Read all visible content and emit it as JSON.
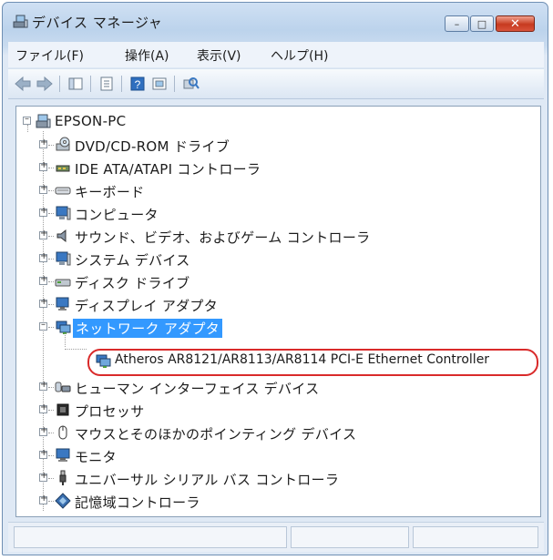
{
  "window": {
    "title": "デバイス マネージャ",
    "accent": "#bcd3ec",
    "controls": {
      "minimize": "–",
      "maximize": "□",
      "close": "✕"
    }
  },
  "menu": [
    "ファイル(F)",
    "操作(A)",
    "表示(V)",
    "ヘルプ(H)"
  ],
  "tree": {
    "root": "EPSON-PC",
    "categories": [
      "DVD/CD-ROM ドライブ",
      "IDE ATA/ATAPI コントローラ",
      "キーボード",
      "コンピュータ",
      "サウンド、ビデオ、およびゲーム コントローラ",
      "システム デバイス",
      "ディスク ドライブ",
      "ディスプレイ アダプタ",
      "ネットワーク アダプタ",
      "Atheros AR8121/AR8113/AR8114 PCI-E Ethernet Controller",
      "ヒューマン インターフェイス デバイス",
      "プロセッサ",
      "マウスとそのほかのポインティング デバイス",
      "モニタ",
      "ユニバーサル シリアル バス コントローラ",
      "記憶域コントローラ"
    ]
  },
  "colors": {
    "selection": "#3399ff",
    "highlight_oval": "#d92a2a"
  }
}
